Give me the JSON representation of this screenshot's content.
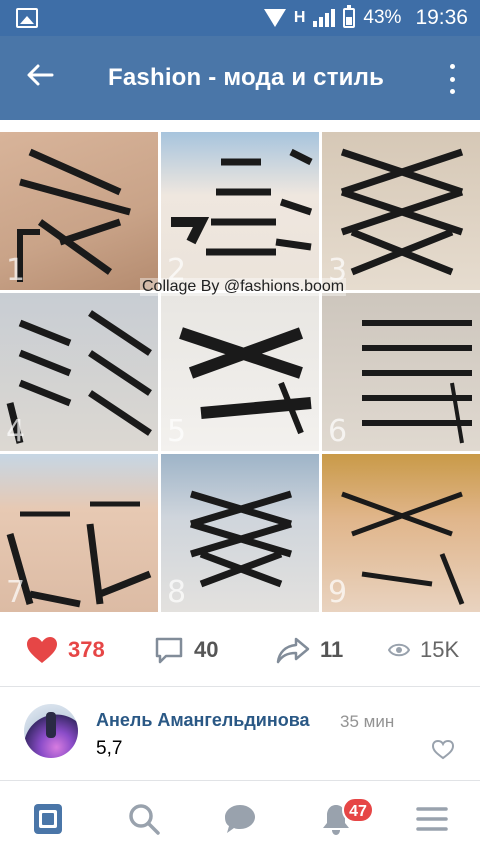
{
  "status_bar": {
    "network_type": "H",
    "battery_percent": "43%",
    "time": "19:36"
  },
  "app_bar": {
    "title": "Fashion - мода и стиль"
  },
  "post": {
    "image_watermark": "Collage By @fashions.boom",
    "tile_numbers": [
      "1",
      "2",
      "3",
      "4",
      "5",
      "6",
      "7",
      "8",
      "9"
    ],
    "likes": "378",
    "comments": "40",
    "shares": "11",
    "views": "15K"
  },
  "comment": {
    "author": "Анель Амангельдинова",
    "time": "35 мин",
    "text": "5,7"
  },
  "bottom_nav": {
    "notifications_badge": "47"
  },
  "colors": {
    "status_bar": "#3e6ea7",
    "app_bar": "#4a76a8",
    "like_red": "#e64646",
    "author_blue": "#2a5885",
    "nav_active": "#4a76a8",
    "nav_inactive": "#99a2ad"
  },
  "icons": {
    "status": [
      "gallery-icon",
      "wifi-icon",
      "signal-icon",
      "battery-icon"
    ],
    "app_bar": [
      "back-arrow-icon",
      "more-vertical-icon"
    ],
    "actions": [
      "heart-icon",
      "comment-icon",
      "share-icon",
      "eye-icon"
    ],
    "nav": [
      "newsfeed-icon",
      "search-icon",
      "messages-icon",
      "bell-icon",
      "menu-icon"
    ]
  }
}
